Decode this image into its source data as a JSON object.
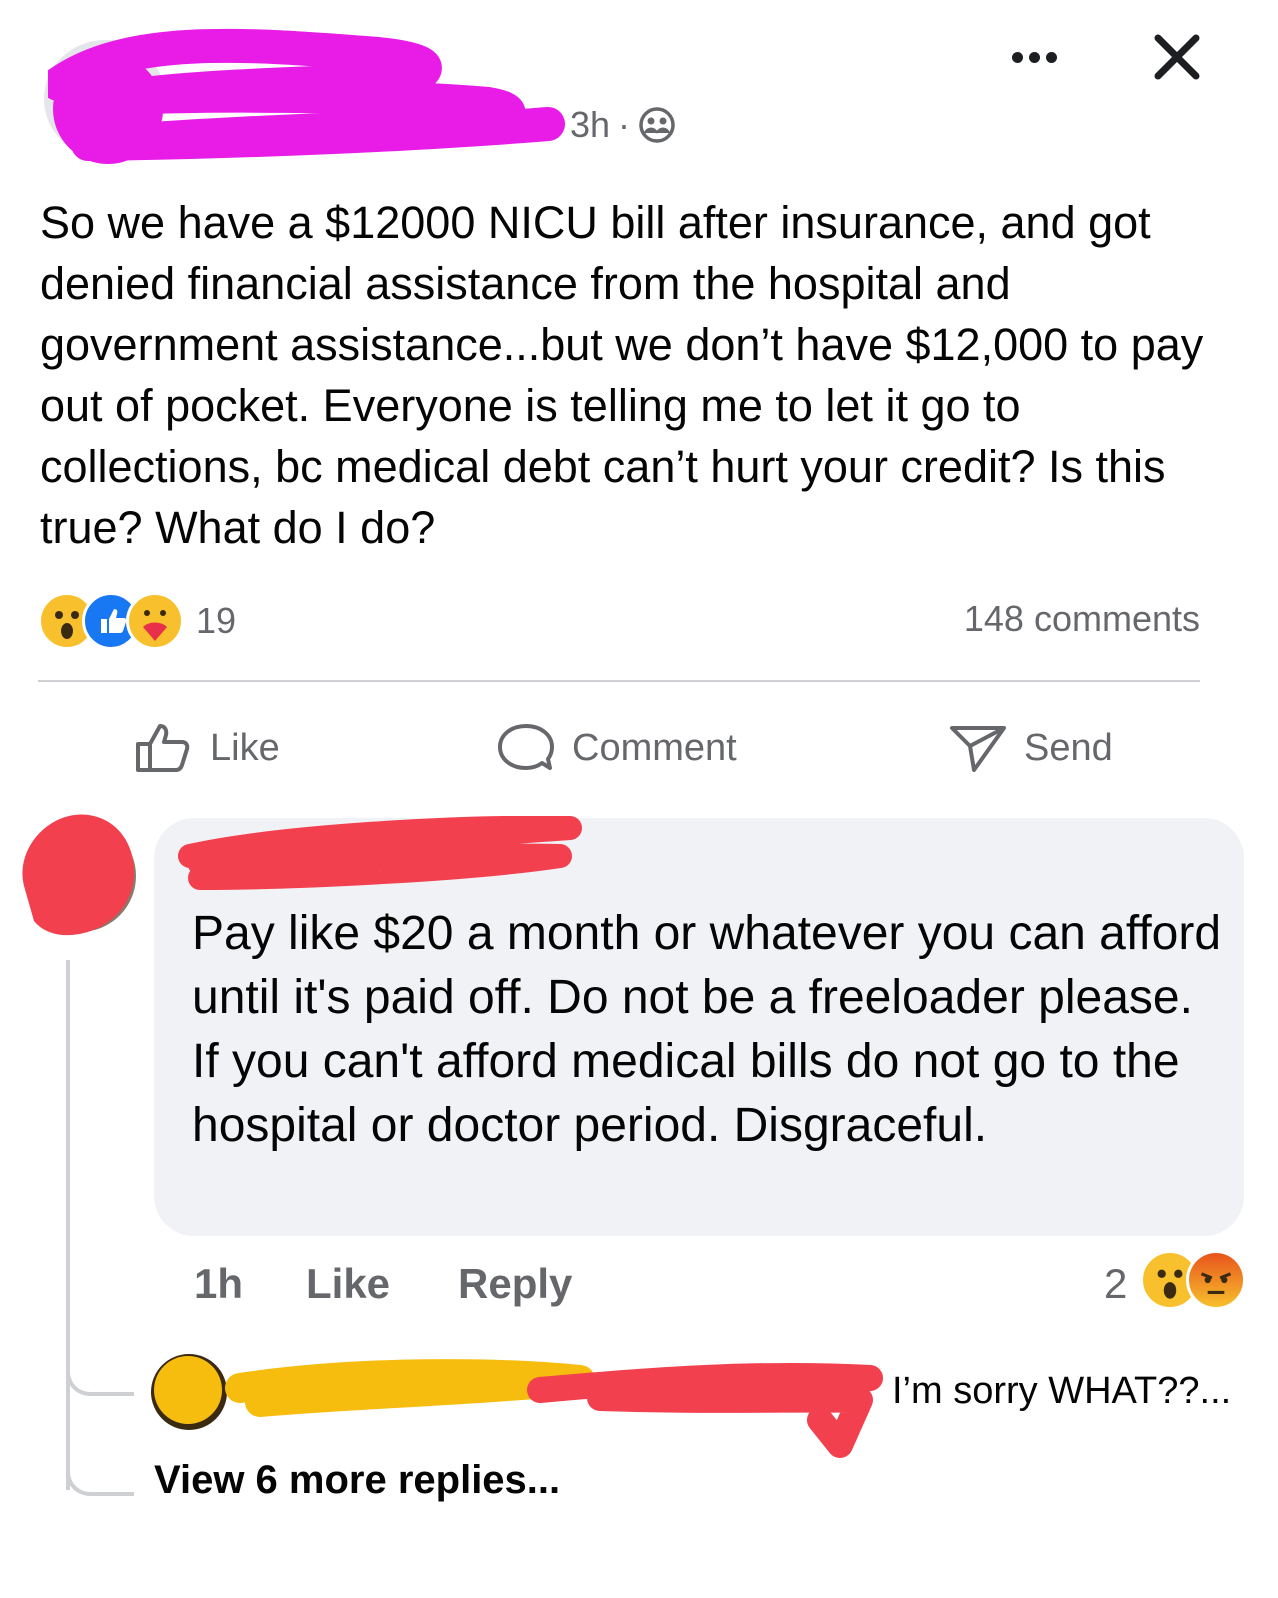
{
  "post": {
    "time": "3h",
    "separator": "·",
    "privacy_icon": "friends-icon",
    "text": "So we have a $12000 NICU bill after insurance, and got denied financial assistance from the hospital and government assistance...but we don’t have $12,000 to pay out of pocket. Everyone is telling me to let it go to collections, bc medical debt can’t hurt your credit? Is this true? What do I do?",
    "reaction_count": "19",
    "comment_count": "148 comments",
    "reactions": [
      "wow",
      "like",
      "care"
    ]
  },
  "actions": {
    "like": "Like",
    "comment": "Comment",
    "send": "Send"
  },
  "comment": {
    "text": "Pay like $20 a month or whatever you can afford until it's paid off. Do not be a freeloader please. If you can't afford medical bills do not go to the hospital or doctor period. Disgraceful.",
    "time": "1h",
    "like": "Like",
    "reply": "Reply",
    "reaction_count": "2",
    "reactions": [
      "wow",
      "angry"
    ]
  },
  "reply_preview": {
    "text": "I’m sorry WHAT??..."
  },
  "view_more": "View 6 more replies...",
  "colors": {
    "redact_magenta": "#e81ce6",
    "redact_red": "#f2404f",
    "redact_yellow": "#f6bd0f",
    "like_blue": "#1877f2"
  }
}
